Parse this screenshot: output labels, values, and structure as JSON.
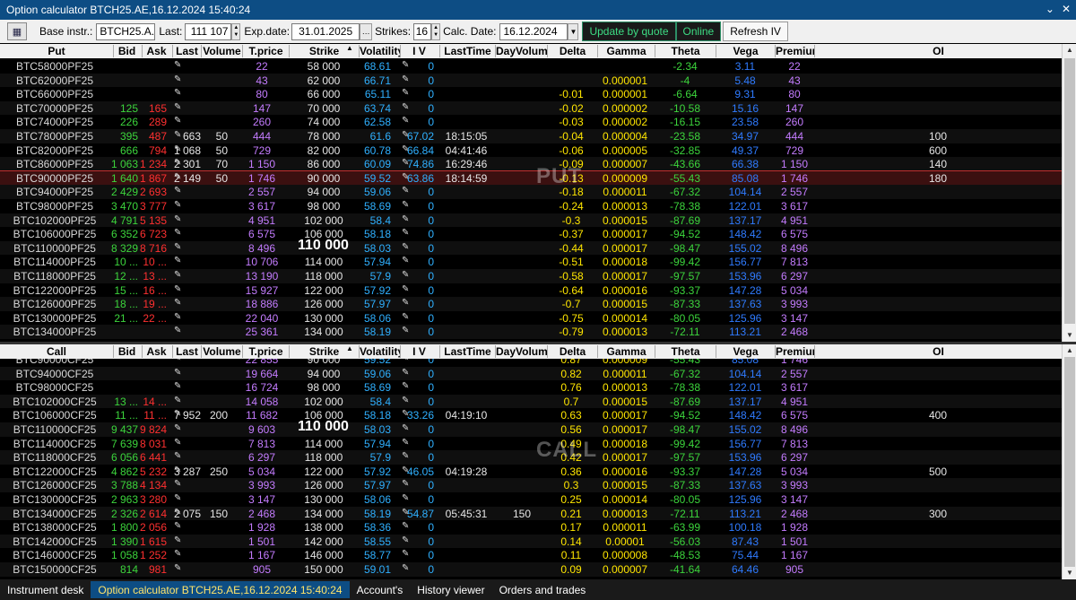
{
  "window": {
    "title": "Option calculator BTCH25.AE,16.12.2024 15:40:24",
    "controls": [
      "⌄",
      "✕"
    ]
  },
  "toolbar": {
    "base_label": "Base instr.:",
    "base_value": "BTCH25.A...",
    "last_label": "Last:",
    "last_value": "111 107",
    "exp_label": "Exp.date:",
    "exp_value": "31.01.2025",
    "strikes_label": "Strikes:",
    "strikes_value": "16",
    "calc_label": "Calc. Date:",
    "calc_value": "16.12.2024",
    "update_btn": "Update by quote",
    "online_btn": "Online",
    "refresh_btn": "Refresh IV"
  },
  "put": {
    "headers": [
      "Put",
      "Bid",
      "Ask",
      "Last",
      "Volume",
      "T.price",
      "Strike",
      "Volatility",
      "I V",
      "LastTime",
      "DayVolume",
      "Delta",
      "Gamma",
      "Theta",
      "Vega",
      "Premium",
      "OI"
    ],
    "watermark": "PUT",
    "atm_label": "110 000",
    "rows": [
      {
        "name": "BTC58000PF25",
        "bid": "",
        "ask": "",
        "last": "",
        "vol": "",
        "tp": "22",
        "strike": "58 000",
        "v": "68.61",
        "iv": "0",
        "lt": "",
        "dv": "",
        "delta": "",
        "gamma": "",
        "theta": "-2.34",
        "vega": "3.11",
        "prem": "22",
        "oi": ""
      },
      {
        "name": "BTC62000PF25",
        "bid": "",
        "ask": "",
        "last": "",
        "vol": "",
        "tp": "43",
        "strike": "62 000",
        "v": "66.71",
        "iv": "0",
        "lt": "",
        "dv": "",
        "delta": "",
        "gamma": "0.000001",
        "theta": "-4",
        "vega": "5.48",
        "prem": "43",
        "oi": ""
      },
      {
        "name": "BTC66000PF25",
        "bid": "",
        "ask": "",
        "last": "",
        "vol": "",
        "tp": "80",
        "strike": "66 000",
        "v": "65.11",
        "iv": "0",
        "lt": "",
        "dv": "",
        "delta": "-0.01",
        "gamma": "0.000001",
        "theta": "-6.64",
        "vega": "9.31",
        "prem": "80",
        "oi": ""
      },
      {
        "name": "BTC70000PF25",
        "bid": "125",
        "ask": "165",
        "last": "",
        "vol": "",
        "tp": "147",
        "strike": "70 000",
        "v": "63.74",
        "iv": "0",
        "lt": "",
        "dv": "",
        "delta": "-0.02",
        "gamma": "0.000002",
        "theta": "-10.58",
        "vega": "15.16",
        "prem": "147",
        "oi": ""
      },
      {
        "name": "BTC74000PF25",
        "bid": "226",
        "ask": "289",
        "last": "",
        "vol": "",
        "tp": "260",
        "strike": "74 000",
        "v": "62.58",
        "iv": "0",
        "lt": "",
        "dv": "",
        "delta": "-0.03",
        "gamma": "0.000002",
        "theta": "-16.15",
        "vega": "23.58",
        "prem": "260",
        "oi": ""
      },
      {
        "name": "BTC78000PF25",
        "bid": "395",
        "ask": "487",
        "last": "663",
        "vol": "50",
        "tp": "444",
        "strike": "78 000",
        "v": "61.6",
        "iv": "67.02",
        "lt": "18:15:05",
        "dv": "",
        "delta": "-0.04",
        "gamma": "0.000004",
        "theta": "-23.58",
        "vega": "34.97",
        "prem": "444",
        "oi": "100"
      },
      {
        "name": "BTC82000PF25",
        "bid": "666",
        "ask": "794",
        "last": "1 068",
        "vol": "50",
        "tp": "729",
        "strike": "82 000",
        "v": "60.78",
        "iv": "66.84",
        "lt": "04:41:46",
        "dv": "",
        "delta": "-0.06",
        "gamma": "0.000005",
        "theta": "-32.85",
        "vega": "49.37",
        "prem": "729",
        "oi": "600"
      },
      {
        "name": "BTC86000PF25",
        "bid": "1 063",
        "ask": "1 234",
        "last": "2 301",
        "vol": "70",
        "tp": "1 150",
        "strike": "86 000",
        "v": "60.09",
        "iv": "74.86",
        "lt": "16:29:46",
        "dv": "",
        "delta": "-0.09",
        "gamma": "0.000007",
        "theta": "-43.66",
        "vega": "66.38",
        "prem": "1 150",
        "oi": "140"
      },
      {
        "name": "BTC90000PF25",
        "bid": "1 640",
        "ask": "1 867",
        "last": "2 149",
        "vol": "50",
        "tp": "1 746",
        "strike": "90 000",
        "v": "59.52",
        "iv": "63.86",
        "lt": "18:14:59",
        "dv": "",
        "delta": "-0.13",
        "gamma": "0.000009",
        "theta": "-55.43",
        "vega": "85.08",
        "prem": "1 746",
        "oi": "180",
        "sel": true
      },
      {
        "name": "BTC94000PF25",
        "bid": "2 429",
        "ask": "2 693",
        "last": "",
        "vol": "",
        "tp": "2 557",
        "strike": "94 000",
        "v": "59.06",
        "iv": "0",
        "lt": "",
        "dv": "",
        "delta": "-0.18",
        "gamma": "0.000011",
        "theta": "-67.32",
        "vega": "104.14",
        "prem": "2 557",
        "oi": ""
      },
      {
        "name": "BTC98000PF25",
        "bid": "3 470",
        "ask": "3 777",
        "last": "",
        "vol": "",
        "tp": "3 617",
        "strike": "98 000",
        "v": "58.69",
        "iv": "0",
        "lt": "",
        "dv": "",
        "delta": "-0.24",
        "gamma": "0.000013",
        "theta": "-78.38",
        "vega": "122.01",
        "prem": "3 617",
        "oi": ""
      },
      {
        "name": "BTC102000PF25",
        "bid": "4 791",
        "ask": "5 135",
        "last": "",
        "vol": "",
        "tp": "4 951",
        "strike": "102 000",
        "v": "58.4",
        "iv": "0",
        "lt": "",
        "dv": "",
        "delta": "-0.3",
        "gamma": "0.000015",
        "theta": "-87.69",
        "vega": "137.17",
        "prem": "4 951",
        "oi": ""
      },
      {
        "name": "BTC106000PF25",
        "bid": "6 352",
        "ask": "6 723",
        "last": "",
        "vol": "",
        "tp": "6 575",
        "strike": "106 000",
        "v": "58.18",
        "iv": "0",
        "lt": "",
        "dv": "",
        "delta": "-0.37",
        "gamma": "0.000017",
        "theta": "-94.52",
        "vega": "148.42",
        "prem": "6 575",
        "oi": ""
      },
      {
        "name": "BTC110000PF25",
        "bid": "8 329",
        "ask": "8 716",
        "last": "",
        "vol": "",
        "tp": "8 496",
        "strike": "",
        "v": "58.03",
        "iv": "0",
        "lt": "",
        "dv": "",
        "delta": "-0.44",
        "gamma": "0.000017",
        "theta": "-98.47",
        "vega": "155.02",
        "prem": "8 496",
        "oi": "",
        "atm": true
      },
      {
        "name": "BTC114000PF25",
        "bid": "10 ...",
        "ask": "10 ...",
        "last": "",
        "vol": "",
        "tp": "10 706",
        "strike": "114 000",
        "v": "57.94",
        "iv": "0",
        "lt": "",
        "dv": "",
        "delta": "-0.51",
        "gamma": "0.000018",
        "theta": "-99.42",
        "vega": "156.77",
        "prem": "7 813",
        "oi": ""
      },
      {
        "name": "BTC118000PF25",
        "bid": "12 ...",
        "ask": "13 ...",
        "last": "",
        "vol": "",
        "tp": "13 190",
        "strike": "118 000",
        "v": "57.9",
        "iv": "0",
        "lt": "",
        "dv": "",
        "delta": "-0.58",
        "gamma": "0.000017",
        "theta": "-97.57",
        "vega": "153.96",
        "prem": "6 297",
        "oi": ""
      },
      {
        "name": "BTC122000PF25",
        "bid": "15 ...",
        "ask": "16 ...",
        "last": "",
        "vol": "",
        "tp": "15 927",
        "strike": "122 000",
        "v": "57.92",
        "iv": "0",
        "lt": "",
        "dv": "",
        "delta": "-0.64",
        "gamma": "0.000016",
        "theta": "-93.37",
        "vega": "147.28",
        "prem": "5 034",
        "oi": ""
      },
      {
        "name": "BTC126000PF25",
        "bid": "18 ...",
        "ask": "19 ...",
        "last": "",
        "vol": "",
        "tp": "18 886",
        "strike": "126 000",
        "v": "57.97",
        "iv": "0",
        "lt": "",
        "dv": "",
        "delta": "-0.7",
        "gamma": "0.000015",
        "theta": "-87.33",
        "vega": "137.63",
        "prem": "3 993",
        "oi": ""
      },
      {
        "name": "BTC130000PF25",
        "bid": "21 ...",
        "ask": "22 ...",
        "last": "",
        "vol": "",
        "tp": "22 040",
        "strike": "130 000",
        "v": "58.06",
        "iv": "0",
        "lt": "",
        "dv": "",
        "delta": "-0.75",
        "gamma": "0.000014",
        "theta": "-80.05",
        "vega": "125.96",
        "prem": "3 147",
        "oi": ""
      },
      {
        "name": "BTC134000PF25",
        "bid": "",
        "ask": "",
        "last": "",
        "vol": "",
        "tp": "25 361",
        "strike": "134 000",
        "v": "58.19",
        "iv": "0",
        "lt": "",
        "dv": "",
        "delta": "-0.79",
        "gamma": "0.000013",
        "theta": "-72.11",
        "vega": "113.21",
        "prem": "2 468",
        "oi": ""
      }
    ]
  },
  "call": {
    "headers": [
      "Call",
      "Bid",
      "Ask",
      "Last",
      "Volume",
      "T.price",
      "Strike",
      "Volatility",
      "I V",
      "LastTime",
      "DayVolume",
      "Delta",
      "Gamma",
      "Theta",
      "Vega",
      "Premium",
      "OI"
    ],
    "watermark": "CALL",
    "atm_label": "110 000",
    "rows": [
      {
        "name": "BTC90000CF25",
        "bid": "",
        "ask": "",
        "last": "",
        "vol": "",
        "tp": "22 855",
        "strike": "90 000",
        "v": "59.52",
        "iv": "0",
        "lt": "",
        "dv": "",
        "delta": "0.87",
        "gamma": "0.000009",
        "theta": "-55.43",
        "vega": "85.08",
        "prem": "1 746",
        "oi": "",
        "partial": true
      },
      {
        "name": "BTC94000CF25",
        "bid": "",
        "ask": "",
        "last": "",
        "vol": "",
        "tp": "19 664",
        "strike": "94 000",
        "v": "59.06",
        "iv": "0",
        "lt": "",
        "dv": "",
        "delta": "0.82",
        "gamma": "0.000011",
        "theta": "-67.32",
        "vega": "104.14",
        "prem": "2 557",
        "oi": ""
      },
      {
        "name": "BTC98000CF25",
        "bid": "",
        "ask": "",
        "last": "",
        "vol": "",
        "tp": "16 724",
        "strike": "98 000",
        "v": "58.69",
        "iv": "0",
        "lt": "",
        "dv": "",
        "delta": "0.76",
        "gamma": "0.000013",
        "theta": "-78.38",
        "vega": "122.01",
        "prem": "3 617",
        "oi": ""
      },
      {
        "name": "BTC102000CF25",
        "bid": "13 ...",
        "ask": "14 ...",
        "last": "",
        "vol": "",
        "tp": "14 058",
        "strike": "102 000",
        "v": "58.4",
        "iv": "0",
        "lt": "",
        "dv": "",
        "delta": "0.7",
        "gamma": "0.000015",
        "theta": "-87.69",
        "vega": "137.17",
        "prem": "4 951",
        "oi": ""
      },
      {
        "name": "BTC106000CF25",
        "bid": "11 ...",
        "ask": "11 ...",
        "last": "7 952",
        "vol": "200",
        "tp": "11 682",
        "strike": "106 000",
        "v": "58.18",
        "iv": "33.26",
        "lt": "04:19:10",
        "dv": "",
        "delta": "0.63",
        "gamma": "0.000017",
        "theta": "-94.52",
        "vega": "148.42",
        "prem": "6 575",
        "oi": "400"
      },
      {
        "name": "BTC110000CF25",
        "bid": "9 437",
        "ask": "9 824",
        "last": "",
        "vol": "",
        "tp": "9 603",
        "strike": "",
        "v": "58.03",
        "iv": "0",
        "lt": "",
        "dv": "",
        "delta": "0.56",
        "gamma": "0.000017",
        "theta": "-98.47",
        "vega": "155.02",
        "prem": "8 496",
        "oi": "",
        "atm": true
      },
      {
        "name": "BTC114000CF25",
        "bid": "7 639",
        "ask": "8 031",
        "last": "",
        "vol": "",
        "tp": "7 813",
        "strike": "114 000",
        "v": "57.94",
        "iv": "0",
        "lt": "",
        "dv": "",
        "delta": "0.49",
        "gamma": "0.000018",
        "theta": "-99.42",
        "vega": "156.77",
        "prem": "7 813",
        "oi": ""
      },
      {
        "name": "BTC118000CF25",
        "bid": "6 056",
        "ask": "6 441",
        "last": "",
        "vol": "",
        "tp": "6 297",
        "strike": "118 000",
        "v": "57.9",
        "iv": "0",
        "lt": "",
        "dv": "",
        "delta": "0.42",
        "gamma": "0.000017",
        "theta": "-97.57",
        "vega": "153.96",
        "prem": "6 297",
        "oi": ""
      },
      {
        "name": "BTC122000CF25",
        "bid": "4 862",
        "ask": "5 232",
        "last": "3 287",
        "vol": "250",
        "tp": "5 034",
        "strike": "122 000",
        "v": "57.92",
        "iv": "46.05",
        "lt": "04:19:28",
        "dv": "",
        "delta": "0.36",
        "gamma": "0.000016",
        "theta": "-93.37",
        "vega": "147.28",
        "prem": "5 034",
        "oi": "500"
      },
      {
        "name": "BTC126000CF25",
        "bid": "3 788",
        "ask": "4 134",
        "last": "",
        "vol": "",
        "tp": "3 993",
        "strike": "126 000",
        "v": "57.97",
        "iv": "0",
        "lt": "",
        "dv": "",
        "delta": "0.3",
        "gamma": "0.000015",
        "theta": "-87.33",
        "vega": "137.63",
        "prem": "3 993",
        "oi": ""
      },
      {
        "name": "BTC130000CF25",
        "bid": "2 963",
        "ask": "3 280",
        "last": "",
        "vol": "",
        "tp": "3 147",
        "strike": "130 000",
        "v": "58.06",
        "iv": "0",
        "lt": "",
        "dv": "",
        "delta": "0.25",
        "gamma": "0.000014",
        "theta": "-80.05",
        "vega": "125.96",
        "prem": "3 147",
        "oi": ""
      },
      {
        "name": "BTC134000CF25",
        "bid": "2 326",
        "ask": "2 614",
        "last": "2 075",
        "vol": "150",
        "tp": "2 468",
        "strike": "134 000",
        "v": "58.19",
        "iv": "54.87",
        "lt": "05:45:31",
        "dv": "150",
        "delta": "0.21",
        "gamma": "0.000013",
        "theta": "-72.11",
        "vega": "113.21",
        "prem": "2 468",
        "oi": "300"
      },
      {
        "name": "BTC138000CF25",
        "bid": "1 800",
        "ask": "2 056",
        "last": "",
        "vol": "",
        "tp": "1 928",
        "strike": "138 000",
        "v": "58.36",
        "iv": "0",
        "lt": "",
        "dv": "",
        "delta": "0.17",
        "gamma": "0.000011",
        "theta": "-63.99",
        "vega": "100.18",
        "prem": "1 928",
        "oi": ""
      },
      {
        "name": "BTC142000CF25",
        "bid": "1 390",
        "ask": "1 615",
        "last": "",
        "vol": "",
        "tp": "1 501",
        "strike": "142 000",
        "v": "58.55",
        "iv": "0",
        "lt": "",
        "dv": "",
        "delta": "0.14",
        "gamma": "0.00001",
        "theta": "-56.03",
        "vega": "87.43",
        "prem": "1 501",
        "oi": ""
      },
      {
        "name": "BTC146000CF25",
        "bid": "1 058",
        "ask": "1 252",
        "last": "",
        "vol": "",
        "tp": "1 167",
        "strike": "146 000",
        "v": "58.77",
        "iv": "0",
        "lt": "",
        "dv": "",
        "delta": "0.11",
        "gamma": "0.000008",
        "theta": "-48.53",
        "vega": "75.44",
        "prem": "1 167",
        "oi": ""
      },
      {
        "name": "BTC150000CF25",
        "bid": "814",
        "ask": "981",
        "last": "",
        "vol": "",
        "tp": "905",
        "strike": "150 000",
        "v": "59.01",
        "iv": "0",
        "lt": "",
        "dv": "",
        "delta": "0.09",
        "gamma": "0.000007",
        "theta": "-41.64",
        "vega": "64.46",
        "prem": "905",
        "oi": ""
      }
    ]
  },
  "tabs": [
    {
      "label": "Instrument desk",
      "active": false
    },
    {
      "label": "Option calculator BTCH25.AE,16.12.2024 15:40:24",
      "active": true
    },
    {
      "label": "Account's",
      "active": false
    },
    {
      "label": "History viewer",
      "active": false
    },
    {
      "label": "Orders and trades",
      "active": false
    }
  ]
}
